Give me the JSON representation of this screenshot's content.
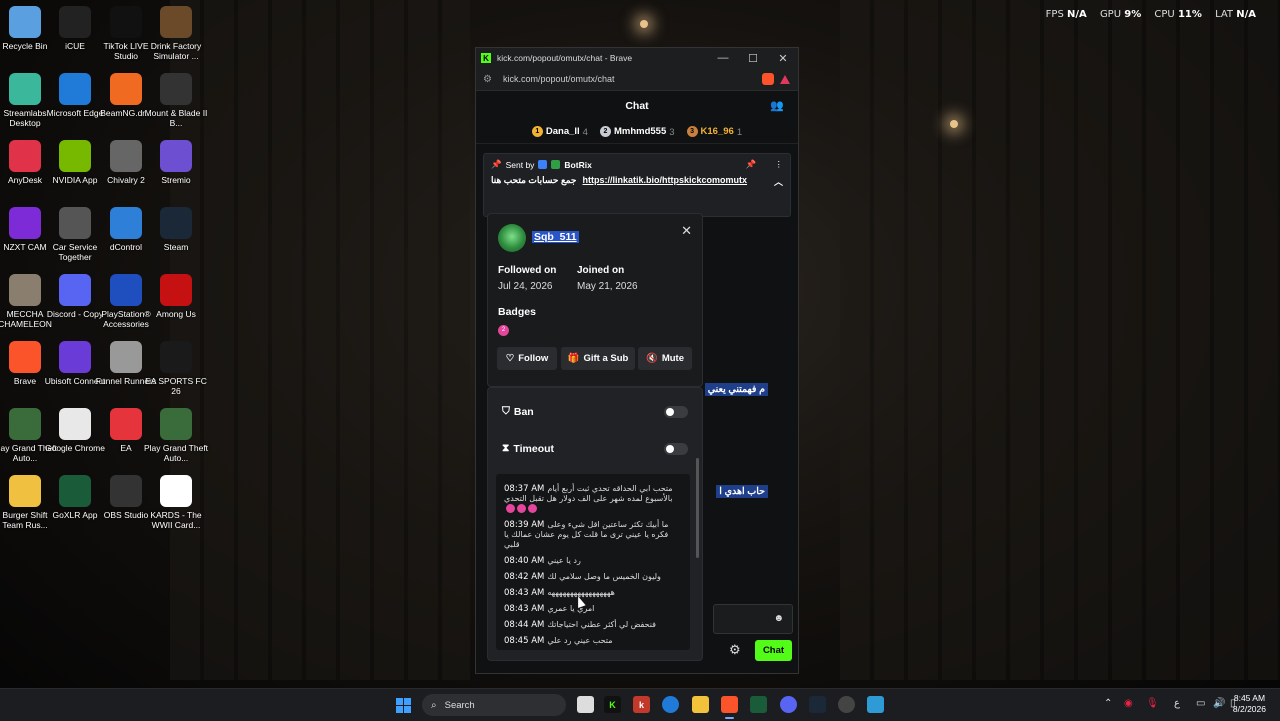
{
  "perf": {
    "fps_label": "FPS",
    "fps": "N/A",
    "gpu_label": "GPU",
    "gpu": "9%",
    "cpu_label": "CPU",
    "cpu": "11%",
    "lat_label": "LAT",
    "lat": "N/A"
  },
  "desktop_icons": [
    {
      "label": "Recycle Bin",
      "icon": "recycle-bin-icon"
    },
    {
      "label": "iCUE",
      "icon": "icue-icon"
    },
    {
      "label": "TikTok LIVE Studio",
      "icon": "tiktok-icon"
    },
    {
      "label": "Drink Factory Simulator ...",
      "icon": "dfs-icon"
    },
    {
      "label": "Streamlabs Desktop",
      "icon": "streamlabs-icon"
    },
    {
      "label": "Microsoft Edge",
      "icon": "edge-icon"
    },
    {
      "label": "BeamNG.dr...",
      "icon": "beamng-icon"
    },
    {
      "label": "Mount & Blade II B...",
      "icon": "bannerlord-icon"
    },
    {
      "label": "AnyDesk",
      "icon": "anydesk-icon"
    },
    {
      "label": "NVIDIA App",
      "icon": "nvidia-icon"
    },
    {
      "label": "Chivalry 2",
      "icon": "chivalry-icon"
    },
    {
      "label": "Stremio",
      "icon": "stremio-icon"
    },
    {
      "label": "NZXT CAM",
      "icon": "nzxt-icon"
    },
    {
      "label": "Car Service Together",
      "icon": "car-service-icon"
    },
    {
      "label": "dControl",
      "icon": "dcontrol-icon"
    },
    {
      "label": "Steam",
      "icon": "steam-icon"
    },
    {
      "label": "MECCHA CHAMELEON",
      "icon": "meccha-icon"
    },
    {
      "label": "Discord - Copy",
      "icon": "discord-icon"
    },
    {
      "label": "PlayStation® Accessories",
      "icon": "playstation-icon"
    },
    {
      "label": "Among Us",
      "icon": "among-us-icon"
    },
    {
      "label": "Brave",
      "icon": "brave-icon"
    },
    {
      "label": "Ubisoft Connect",
      "icon": "ubisoft-icon"
    },
    {
      "label": "Funnel Runners",
      "icon": "funnel-runners-icon"
    },
    {
      "label": "EA SPORTS FC 26",
      "icon": "fc26-icon"
    },
    {
      "label": "Play Grand Theft Auto...",
      "icon": "gta-icon"
    },
    {
      "label": "Google Chrome",
      "icon": "chrome-icon"
    },
    {
      "label": "EA",
      "icon": "ea-icon"
    },
    {
      "label": "Play Grand Theft Auto...",
      "icon": "gta-icon"
    },
    {
      "label": "Burger Shift Team Rus...",
      "icon": "burger-shift-icon"
    },
    {
      "label": "GoXLR App",
      "icon": "goxlr-icon"
    },
    {
      "label": "OBS Studio",
      "icon": "obs-icon"
    },
    {
      "label": "KARDS - The WWII Card...",
      "icon": "kards-icon"
    }
  ],
  "browser": {
    "title": "kick.com/popout/omutx/chat - Brave",
    "url": "kick.com/popout/omutx/chat"
  },
  "chat": {
    "header": "Chat",
    "leaders": [
      {
        "rank": "1",
        "name": "Dana_ll",
        "count": "4",
        "color": "#f2b233"
      },
      {
        "rank": "2",
        "name": "Mmhmd555",
        "count": "3",
        "color": "#c8ccd2"
      },
      {
        "rank": "3",
        "name": "K16_96",
        "count": "1",
        "color": "#c9803e"
      }
    ],
    "pinned": {
      "sent_by_label": "Sent by",
      "sender": "BotRix",
      "text": "جمع حسابات متحب هنا",
      "link": "https://linkatik.bio/httpskickcomomutx"
    },
    "selected_lines": [
      "م فهمتني يعني",
      "حاب اهدي ا"
    ],
    "send_label": "Chat"
  },
  "user_card": {
    "username": "Sqb_511",
    "followed_label": "Followed on",
    "followed_date": "Jul 24, 2026",
    "joined_label": "Joined on",
    "joined_date": "May 21, 2026",
    "badges_label": "Badges",
    "follow_label": "Follow",
    "gift_label": "Gift a Sub",
    "mute_label": "Mute",
    "ban_label": "Ban",
    "timeout_label": "Timeout",
    "messages": [
      {
        "time": "08:37 AM",
        "text": "متحب ابي الحداقه تحدي ثبت أربع أيام بالأسبوع لمده شهر على الف دولار هل تقبل التحدي"
      },
      {
        "time": "08:39 AM",
        "text": "ما أبيك تكثر ساعتين اقل شيء وعلى فكره يا عيني ترى ما قلت كل يوم عشان عمالك يا قلبي"
      },
      {
        "time": "08:40 AM",
        "text": "رد يا عيني"
      },
      {
        "time": "08:42 AM",
        "text": "وليون الخميس ما وصل سلامي لك"
      },
      {
        "time": "08:43 AM",
        "text": "هههههههههههههههههه"
      },
      {
        "time": "08:43 AM",
        "text": "امري يا عمري"
      },
      {
        "time": "08:44 AM",
        "text": "فنحفض لي أكثر عطني احتياجاتك"
      },
      {
        "time": "08:45 AM",
        "text": "متحب عيني رد علي"
      }
    ]
  },
  "taskbar": {
    "search_placeholder": "Search",
    "time": "8:45 AM",
    "date": "8/2/2026",
    "lang": "ع"
  }
}
